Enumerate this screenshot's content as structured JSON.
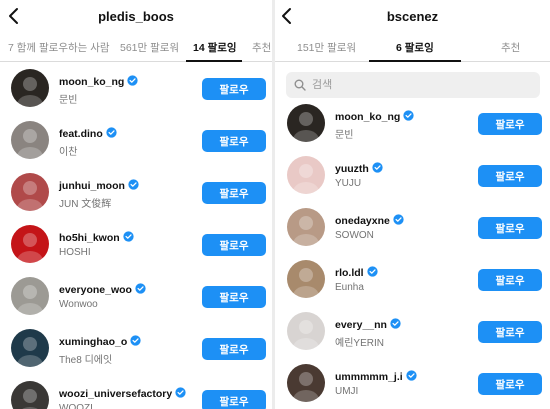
{
  "left": {
    "title": "pledis_boos",
    "tabs": [
      {
        "label": "7 함께 팔로우하는 사람"
      },
      {
        "label": "561만 팔로워"
      },
      {
        "label": "14 팔로잉"
      },
      {
        "label": "추천"
      }
    ],
    "users": [
      {
        "username": "moon_ko_ng",
        "name": "문빈",
        "button": "팔로우",
        "avatar": "#2a2622"
      },
      {
        "username": "feat.dino",
        "name": "이찬",
        "button": "팔로우",
        "avatar": "#8a8480"
      },
      {
        "username": "junhui_moon",
        "name": "JUN 文俊辉",
        "button": "팔로우",
        "avatar": "#b04a4a"
      },
      {
        "username": "ho5hi_kwon",
        "name": "HOSHI",
        "button": "팔로우",
        "avatar": "#c41418"
      },
      {
        "username": "everyone_woo",
        "name": "Wonwoo",
        "button": "팔로우",
        "avatar": "#9c9a94"
      },
      {
        "username": "xuminghao_o",
        "name": "The8 디에잇",
        "button": "팔로우",
        "avatar": "#1f3a4a"
      },
      {
        "username": "woozi_universefactory",
        "name": "WOOZI",
        "button": "팔로우",
        "avatar": "#3a3836"
      }
    ]
  },
  "right": {
    "title": "bscenez",
    "tabs": [
      {
        "label": "151만 팔로워"
      },
      {
        "label": "6 팔로잉"
      },
      {
        "label": "추천"
      }
    ],
    "search_placeholder": "검색",
    "users": [
      {
        "username": "moon_ko_ng",
        "name": "문빈",
        "button": "팔로우",
        "avatar": "#2a2622"
      },
      {
        "username": "yuuzth",
        "name": "YUJU",
        "button": "팔로우",
        "avatar": "#e9c9c6"
      },
      {
        "username": "onedayxne",
        "name": "SOWON",
        "button": "팔로우",
        "avatar": "#b89a86"
      },
      {
        "username": "rlo.ldl",
        "name": "Eunha",
        "button": "팔로우",
        "avatar": "#a88a6c"
      },
      {
        "username": "every__nn",
        "name": "예린YERIN",
        "button": "팔로우",
        "avatar": "#d8d4d2"
      },
      {
        "username": "ummmmm_j.i",
        "name": "UMJI",
        "button": "팔로우",
        "avatar": "#4a3a32"
      }
    ]
  },
  "colors": {
    "accent": "#1d90f5",
    "verified": "#1d90f5"
  },
  "icons": [
    "back-arrow-icon",
    "search-icon",
    "verified-badge-icon"
  ]
}
